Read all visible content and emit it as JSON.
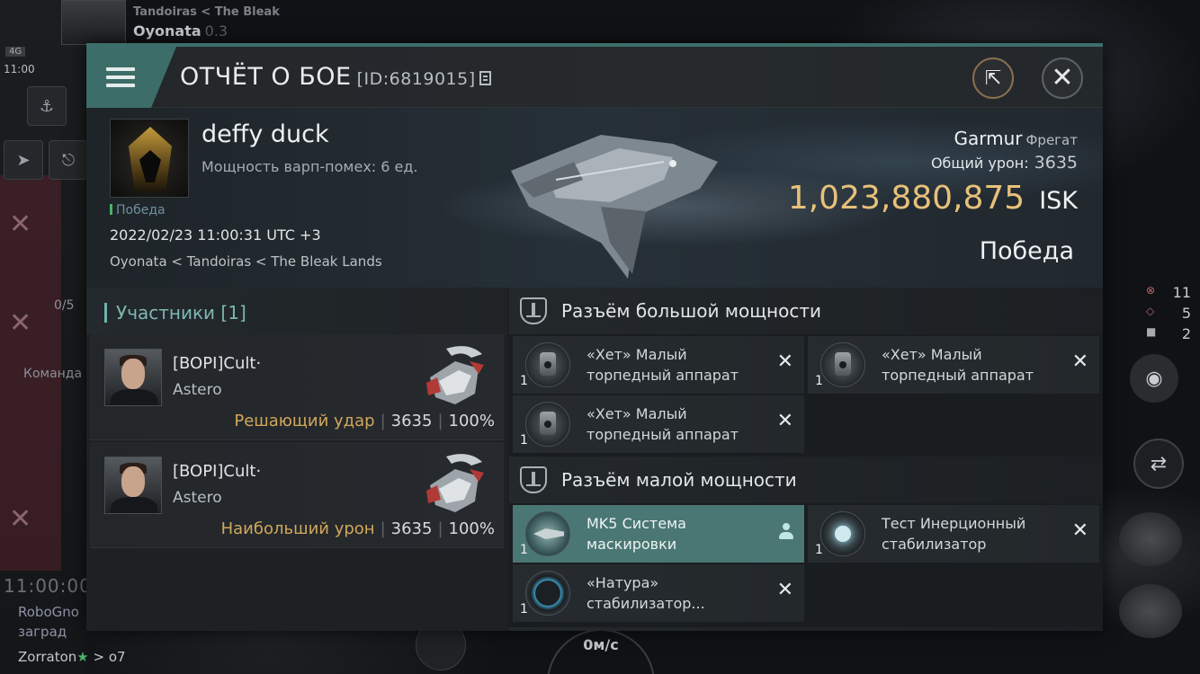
{
  "background": {
    "system_path": "Tandoiras  < The Bleak",
    "system_name": "Oyonata",
    "security": "0.3",
    "signal": "4G",
    "time": "11:00",
    "local_count": "0/5",
    "command_label": "Команда",
    "clock": "11:00:00",
    "chat_lines": [
      "RoboGno",
      "заград",
      "Zorraton"
    ],
    "chat_tail": "> o7",
    "speed": "0м/с",
    "right_stats": [
      {
        "icon": "target-icon",
        "value": "11"
      },
      {
        "icon": "ship-icon",
        "value": "5"
      },
      {
        "icon": "square-icon",
        "value": "2"
      }
    ]
  },
  "report": {
    "title": "ОТЧЁТ О БОЕ",
    "report_id": "[ID:6819015]",
    "victim": {
      "name": "deffy duck",
      "warp_scramble": "Мощность варп-помех: 6 ед.",
      "result_small": "Победа",
      "datetime": "2022/02/23 11:00:31 UTC +3",
      "location": "Oyonata < Tandoiras < The Bleak Lands"
    },
    "ship": {
      "name": "Garmur",
      "class": "Фрегат",
      "total_damage_label": "Общий урон:",
      "total_damage": "3635",
      "isk_value": "1,023,880,875",
      "isk_unit": "ISK",
      "outcome": "Победа"
    },
    "participants": {
      "header": "Участники [1]",
      "list": [
        {
          "corp": "[BOPI]Cult·",
          "ship": "Astero",
          "role": "Решающий удар",
          "damage": "3635",
          "percent": "100%"
        },
        {
          "corp": "[BOPI]Cult·",
          "ship": "Astero",
          "role": "Наибольший урон",
          "damage": "3635",
          "percent": "100%"
        }
      ]
    },
    "high_slots": {
      "header": "Разъём большой мощности",
      "modules": [
        {
          "name": "«Хет» Малый торпедный аппарат",
          "qty": "1",
          "state": "destroyed"
        },
        {
          "name": "«Хет» Малый торпедный аппарат",
          "qty": "1",
          "state": "destroyed"
        },
        {
          "name": "«Хет» Малый торпедный аппарат",
          "qty": "1",
          "state": "destroyed"
        }
      ]
    },
    "low_slots": {
      "header": "Разъём малой мощности",
      "modules": [
        {
          "name": "MK5 Система маскировки",
          "qty": "1",
          "state": "dropped"
        },
        {
          "name": "Тест Инерционный стабилизатор",
          "qty": "1",
          "state": "destroyed"
        },
        {
          "name": "«Натура» стабилизатор...",
          "qty": "1",
          "state": "destroyed"
        }
      ]
    }
  },
  "colors": {
    "accent": "#3c6d69",
    "isk": "#e7c17a",
    "role": "#d2a75b"
  }
}
